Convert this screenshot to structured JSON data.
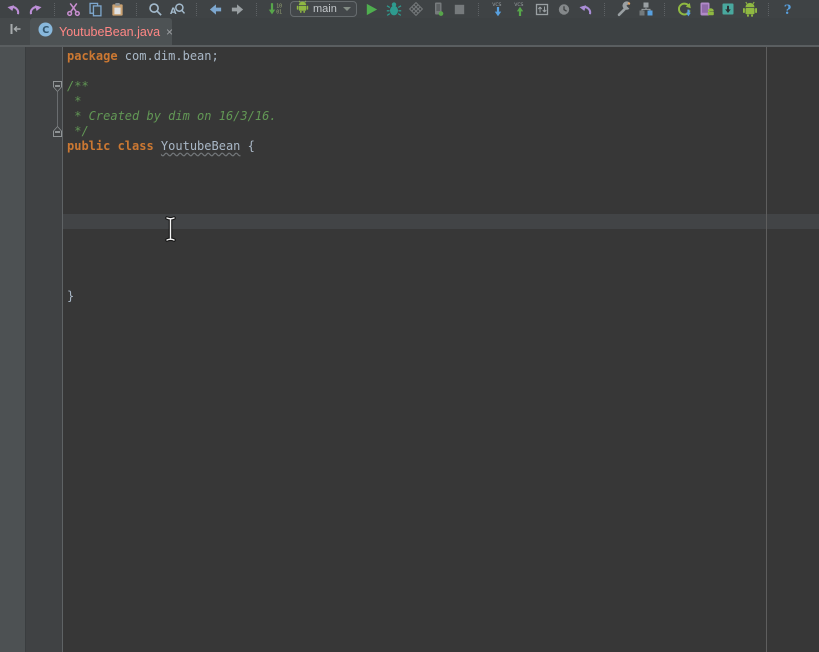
{
  "colors": {
    "editor_background": "#373737",
    "gutter_background": "#404244",
    "caret_line_highlight": "#424446",
    "keyword": "#cc7832",
    "plain_text": "#a9b7c6",
    "comment": "#629755",
    "active_tab_text": "#ff8785",
    "run_green": "#4fae4f",
    "debug_teal": "#2e9b8f",
    "margin_guide": "#5e5e5e"
  },
  "toolbar": {
    "run_config": {
      "label": "main"
    },
    "items": [
      {
        "type": "icon",
        "name": "undo-icon"
      },
      {
        "type": "icon",
        "name": "redo-icon"
      },
      {
        "type": "separator"
      },
      {
        "type": "icon",
        "name": "cut-icon"
      },
      {
        "type": "icon",
        "name": "copy-icon"
      },
      {
        "type": "icon",
        "name": "paste-icon"
      },
      {
        "type": "separator"
      },
      {
        "type": "icon",
        "name": "find-icon"
      },
      {
        "type": "icon",
        "name": "replace-icon"
      },
      {
        "type": "separator"
      },
      {
        "type": "icon",
        "name": "back-icon"
      },
      {
        "type": "icon",
        "name": "forward-icon"
      },
      {
        "type": "separator"
      },
      {
        "type": "icon",
        "name": "compile-icon"
      },
      {
        "type": "run-config",
        "name": "run-config-select"
      },
      {
        "type": "icon",
        "name": "run-icon"
      },
      {
        "type": "icon",
        "name": "debug-icon"
      },
      {
        "type": "icon",
        "name": "coverage-icon"
      },
      {
        "type": "icon",
        "name": "attach-debugger-icon"
      },
      {
        "type": "icon",
        "name": "stop-icon"
      },
      {
        "type": "separator"
      },
      {
        "type": "icon",
        "name": "vcs-update-icon"
      },
      {
        "type": "icon",
        "name": "vcs-commit-icon"
      },
      {
        "type": "icon",
        "name": "compare-icon"
      },
      {
        "type": "icon",
        "name": "recent-changes-icon"
      },
      {
        "type": "icon",
        "name": "rollback-icon"
      },
      {
        "type": "separator"
      },
      {
        "type": "icon",
        "name": "settings-icon"
      },
      {
        "type": "icon",
        "name": "project-structure-icon"
      },
      {
        "type": "separator"
      },
      {
        "type": "icon",
        "name": "sync-gradle-icon"
      },
      {
        "type": "icon",
        "name": "avd-manager-icon"
      },
      {
        "type": "icon",
        "name": "sdk-manager-icon"
      },
      {
        "type": "icon",
        "name": "device-monitor-icon"
      },
      {
        "type": "separator"
      },
      {
        "type": "icon",
        "name": "help-icon"
      }
    ]
  },
  "tab_bar": {
    "tabs": [
      {
        "label": "YoutubeBean.java",
        "icon": "class-icon",
        "close_label": "×",
        "active": true
      }
    ]
  },
  "editor": {
    "caret_line": 11,
    "fold_regions": [
      {
        "from": 2,
        "to": 5
      }
    ],
    "code": [
      {
        "parts": [
          {
            "text": "package ",
            "style": "keyword"
          },
          {
            "text": "com.dim.bean;",
            "style": "plain"
          }
        ]
      },
      {
        "parts": []
      },
      {
        "parts": [
          {
            "text": "/**",
            "style": "comment"
          }
        ]
      },
      {
        "parts": [
          {
            "text": " *",
            "style": "comment"
          }
        ]
      },
      {
        "parts": [
          {
            "text": " * Created by dim on 16/3/16.",
            "style": "comment"
          }
        ]
      },
      {
        "parts": [
          {
            "text": " */",
            "style": "comment"
          }
        ]
      },
      {
        "parts": [
          {
            "text": "public class ",
            "style": "keyword"
          },
          {
            "text": "YoutubeBean",
            "style": "plain typo"
          },
          {
            "text": " {",
            "style": "plain"
          }
        ]
      },
      {
        "parts": []
      },
      {
        "parts": []
      },
      {
        "parts": []
      },
      {
        "parts": []
      },
      {
        "parts": []
      },
      {
        "parts": []
      },
      {
        "parts": []
      },
      {
        "parts": []
      },
      {
        "parts": []
      },
      {
        "parts": [
          {
            "text": "}",
            "style": "plain"
          }
        ]
      }
    ]
  }
}
